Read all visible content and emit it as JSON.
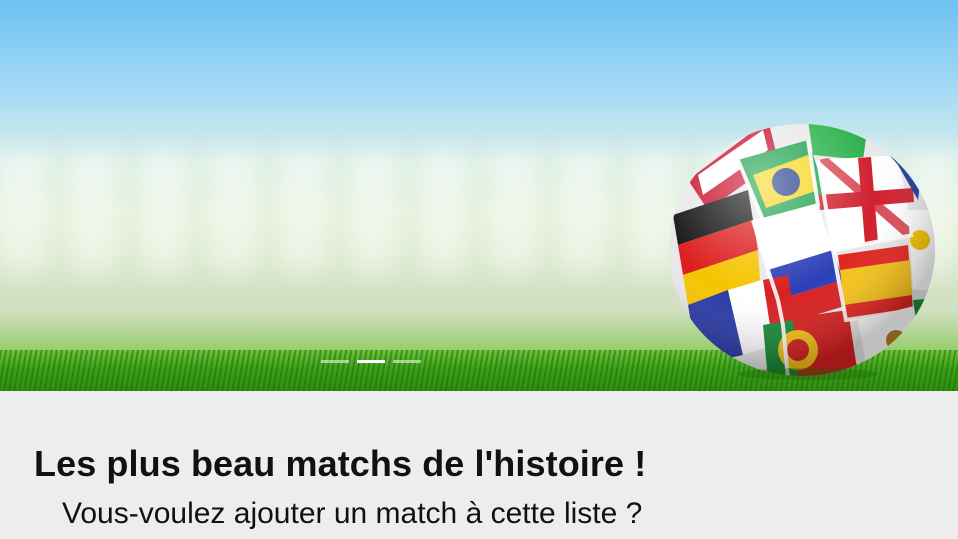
{
  "hero": {
    "image": "football-flags-ball-on-grass",
    "slides": [
      {
        "active": false
      },
      {
        "active": true
      },
      {
        "active": false
      }
    ]
  },
  "content": {
    "title": "Les plus beau matchs de l'histoire !",
    "subtitle": "Vous-voulez ajouter un match à cette liste ?"
  },
  "colors": {
    "background": "#ededed",
    "text": "#111111",
    "grass": "#3da11a",
    "sky": "#6dc2f0"
  }
}
